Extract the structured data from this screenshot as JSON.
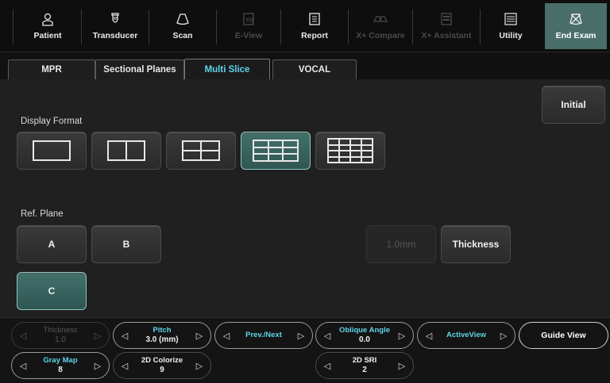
{
  "toolbar": {
    "items": [
      {
        "label": "Patient",
        "icon": "patient-icon",
        "disabled": false
      },
      {
        "label": "Transducer",
        "icon": "transducer-icon",
        "disabled": false
      },
      {
        "label": "Scan",
        "icon": "scan-icon",
        "disabled": false
      },
      {
        "label": "E-View",
        "icon": "eview-icon",
        "disabled": true
      },
      {
        "label": "Report",
        "icon": "report-icon",
        "disabled": false
      },
      {
        "label": "X+ Compare",
        "icon": "compare-icon",
        "disabled": true
      },
      {
        "label": "X+ Assistant",
        "icon": "assistant-icon",
        "disabled": true
      },
      {
        "label": "Utility",
        "icon": "utility-icon",
        "disabled": false
      },
      {
        "label": "End Exam",
        "icon": "end-exam-icon",
        "disabled": false
      }
    ]
  },
  "tabs": [
    {
      "label": "MPR",
      "active": false
    },
    {
      "label": "Sectional Planes",
      "active": false
    },
    {
      "label": "Multi Slice",
      "active": true
    },
    {
      "label": "VOCAL",
      "active": false
    }
  ],
  "main": {
    "initial_label": "Initial",
    "display_format_label": "Display Format",
    "display_formats": [
      {
        "name": "1x1",
        "selected": false
      },
      {
        "name": "1x2",
        "selected": false
      },
      {
        "name": "2x2",
        "selected": false
      },
      {
        "name": "3x3",
        "selected": true
      },
      {
        "name": "4x4",
        "selected": false
      }
    ],
    "ref_plane_label": "Ref. Plane",
    "planes": [
      {
        "label": "A",
        "selected": false
      },
      {
        "label": "B",
        "selected": false
      },
      {
        "label": "C",
        "selected": true
      }
    ],
    "thickness_value": "1.0mm",
    "thickness_button": "Thickness"
  },
  "bottom": {
    "thickness": {
      "title": "Thickness",
      "value": "1.0"
    },
    "pitch": {
      "title": "Pitch",
      "value": "3.0 (mm)"
    },
    "prev_next": {
      "title": "Prev./Next"
    },
    "oblique": {
      "title": "Oblique Angle",
      "value": "0.0"
    },
    "active_view": {
      "title": "ActiveView"
    },
    "guide_view": {
      "title": "Guide View"
    },
    "gray_map": {
      "title": "Gray Map",
      "value": "8"
    },
    "colorize": {
      "title": "2D Colorize",
      "value": "9"
    },
    "sri": {
      "title": "2D SRI",
      "value": "2"
    }
  },
  "colors": {
    "accent": "#5fd4ea",
    "selected": "#3f6b66",
    "end_exam": "#4a6e6a"
  }
}
